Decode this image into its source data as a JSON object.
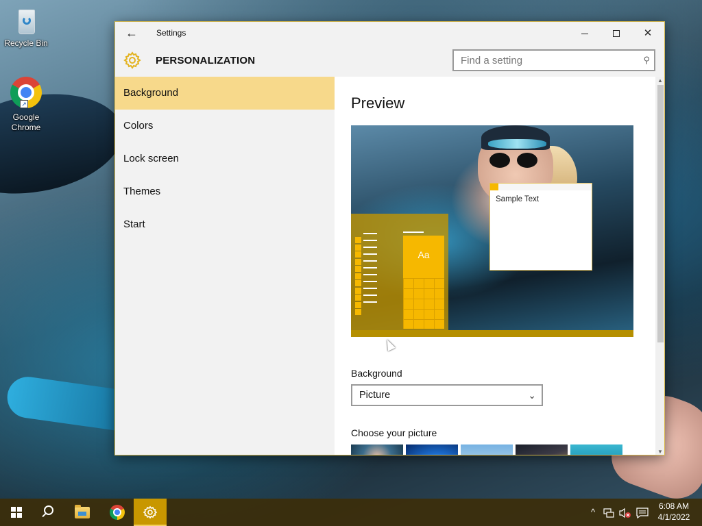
{
  "desktop": {
    "icons": [
      {
        "label": "Recycle Bin",
        "icon": "recycle-bin-icon"
      },
      {
        "label": "Google Chrome",
        "icon": "chrome-icon"
      }
    ]
  },
  "window": {
    "title": "Settings",
    "back_icon": "back-arrow-icon",
    "controls": {
      "minimize": "minimize-icon",
      "maximize": "maximize-icon",
      "close": "close-icon"
    }
  },
  "header": {
    "icon": "gear-icon",
    "title": "PERSONALIZATION",
    "search": {
      "placeholder": "Find a setting",
      "value": "",
      "icon": "search-icon"
    }
  },
  "sidebar": {
    "items": [
      {
        "label": "Background",
        "selected": true
      },
      {
        "label": "Colors",
        "selected": false
      },
      {
        "label": "Lock screen",
        "selected": false
      },
      {
        "label": "Themes",
        "selected": false
      },
      {
        "label": "Start",
        "selected": false
      }
    ]
  },
  "main": {
    "preview_title": "Preview",
    "preview": {
      "sample_text": "Sample Text",
      "tile_text": "Aa"
    },
    "background_label": "Background",
    "background_select": {
      "selected": "Picture"
    },
    "choose_label": "Choose your picture",
    "thumbnails": [
      "picture-1",
      "picture-2",
      "picture-3",
      "picture-4",
      "picture-5"
    ]
  },
  "colors": {
    "accent": "#f6b800",
    "selected_nav": "#f7d98b",
    "taskbar": "#3c2e0a"
  },
  "taskbar": {
    "items": [
      "start-icon",
      "search-icon",
      "file-explorer-icon",
      "chrome-icon",
      "settings-icon"
    ],
    "tray": {
      "up": "^",
      "network": "network-icon",
      "volume": "volume-muted-icon",
      "notifications": "notifications-icon"
    },
    "clock": {
      "time": "6:08 AM",
      "date": "4/1/2022"
    }
  }
}
